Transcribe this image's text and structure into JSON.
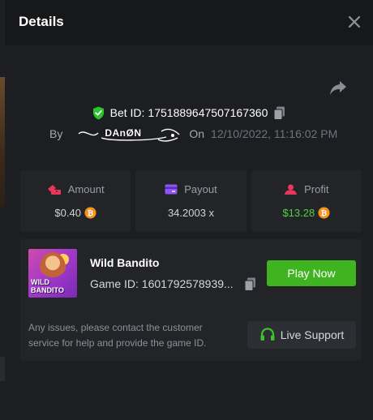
{
  "modal": {
    "title": "Details",
    "close_icon": "close-icon",
    "share_icon": "share-icon"
  },
  "bet": {
    "id_label": "Bet ID:",
    "id_value": "1751889647507167360",
    "by_label": "By",
    "username": "DAnØN",
    "on_label": "On",
    "date": "12/10/2022, 11:16:02 PM"
  },
  "stats": [
    {
      "label": "Amount",
      "value": "$0.40",
      "icon": "amount-icon",
      "coin": true
    },
    {
      "label": "Payout",
      "value": "34.2003 x",
      "icon": "payout-icon",
      "coin": false
    },
    {
      "label": "Profit",
      "value": "$13.28",
      "icon": "profit-icon",
      "coin": true
    }
  ],
  "game": {
    "name": "Wild Bandito",
    "id_label": "Game ID:",
    "id_value": "1601792578939...",
    "thumb_text": "WILD BANDITO",
    "play_label": "Play Now"
  },
  "support": {
    "help_text": "Any issues, please contact the customer service for help and provide the game ID.",
    "button_label": "Live Support"
  },
  "colors": {
    "accent_green": "#3fb420",
    "profit_green": "#4bd53a",
    "coin_orange": "#f7931a",
    "shield_green": "#2bc42b"
  }
}
